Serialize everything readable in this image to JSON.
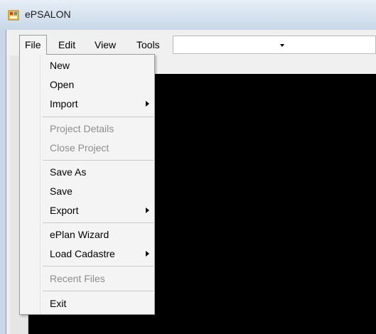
{
  "window": {
    "title": "ePSALON",
    "icon": "app-window-icon"
  },
  "menubar": {
    "file": "File",
    "edit": "Edit",
    "view": "View",
    "tools": "Tools"
  },
  "file_menu": {
    "new": "New",
    "open": "Open",
    "import": "Import",
    "project_details": "Project Details",
    "close_project": "Close Project",
    "save_as": "Save As",
    "save": "Save",
    "export": "Export",
    "eplan_wizard": "ePlan Wizard",
    "load_cadastre": "Load Cadastre",
    "recent_files": "Recent Files",
    "exit": "Exit"
  },
  "toolbar": {
    "combo_value": ""
  },
  "colors": {
    "canvas": "#000000",
    "disabled_text": "#8d8d8d",
    "menu_bg": "#f4f4f4"
  }
}
